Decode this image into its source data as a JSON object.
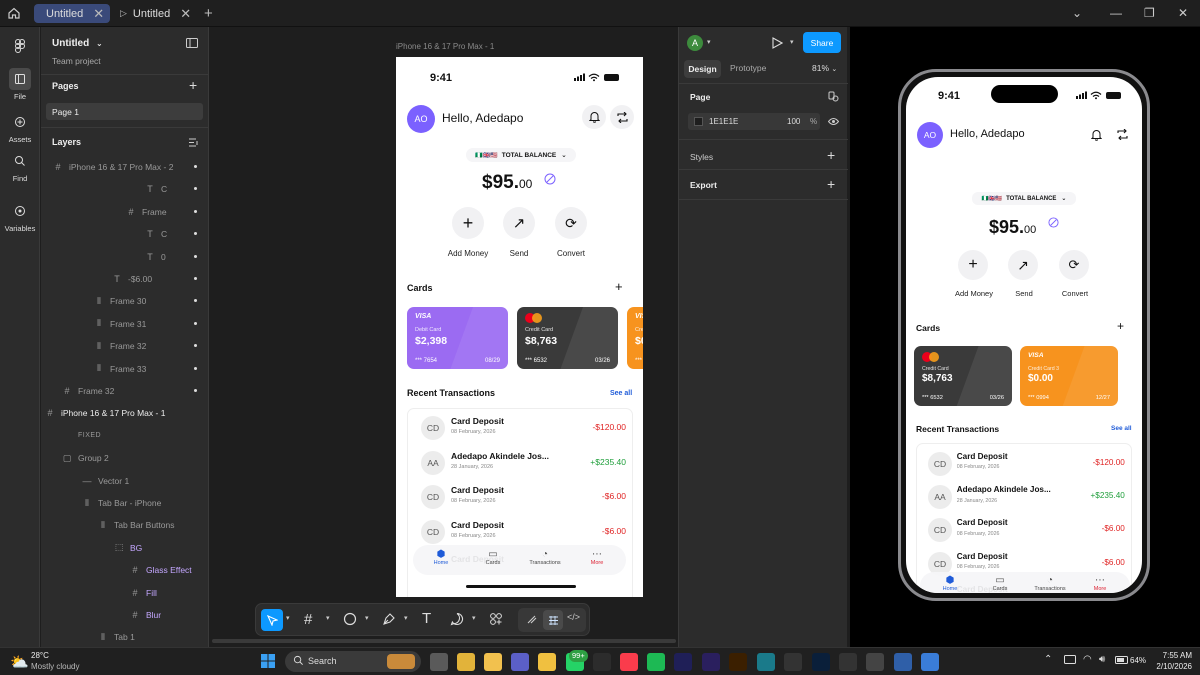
{
  "tabs": [
    {
      "label": "Untitled",
      "active": true
    },
    {
      "label": "Untitled",
      "active": false
    }
  ],
  "rail": {
    "items": [
      {
        "label": "File"
      },
      {
        "label": "Assets"
      },
      {
        "label": "Find"
      },
      {
        "label": "Variables"
      }
    ]
  },
  "file": {
    "name": "Untitled",
    "team": "Team project"
  },
  "pages": {
    "title": "Pages",
    "items": [
      "Page 1"
    ]
  },
  "layers": {
    "title": "Layers",
    "items": [
      {
        "label": "iPhone 16 & 17 Pro Max - 2",
        "icon": "frame"
      },
      {
        "label": "C",
        "icon": "text"
      },
      {
        "label": "Frame",
        "icon": "frame"
      },
      {
        "label": "C",
        "icon": "text"
      },
      {
        "label": "0",
        "icon": "text"
      },
      {
        "label": "-$6.00",
        "icon": "text"
      },
      {
        "label": "Frame 30",
        "icon": "autolayout"
      },
      {
        "label": "Frame 31",
        "icon": "autolayout"
      },
      {
        "label": "Frame 32",
        "icon": "autolayout"
      },
      {
        "label": "Frame 33",
        "icon": "autolayout"
      },
      {
        "label": "Frame 32",
        "icon": "frame"
      },
      {
        "label": "iPhone 16 & 17 Pro Max - 1",
        "icon": "frame"
      },
      {
        "label": "FIXED",
        "icon": ""
      },
      {
        "label": "Group 2",
        "icon": "group"
      },
      {
        "label": "Vector 1",
        "icon": "vector"
      },
      {
        "label": "Tab Bar - iPhone",
        "icon": "autolayout"
      },
      {
        "label": "Tab Bar Buttons",
        "icon": "autolayout"
      },
      {
        "label": "BG",
        "icon": "component"
      },
      {
        "label": "Glass Effect",
        "icon": "frame"
      },
      {
        "label": "Fill",
        "icon": "frame"
      },
      {
        "label": "Blur",
        "icon": "frame"
      },
      {
        "label": "Tab 1",
        "icon": "autolayout"
      }
    ]
  },
  "canvas": {
    "frame_label": "iPhone 16 & 17 Pro Max - 1"
  },
  "app": {
    "time": "9:41",
    "avatar": "AO",
    "greeting": "Hello, Adedapo",
    "balance_label": "TOTAL BALANCE",
    "balance_main": "$95.",
    "balance_cents": "00",
    "actions": [
      "Add Money",
      "Send",
      "Convert"
    ],
    "cards_title": "Cards",
    "cards": [
      {
        "brand": "VISA",
        "type": "Debit Card",
        "amount": "$2,398",
        "number": "*** 7654",
        "expiry": "08/29",
        "color": "#9b6bf2"
      },
      {
        "brand": "mastercard",
        "type": "Credit Card",
        "amount": "$8,763",
        "number": "*** 6532",
        "expiry": "03/26",
        "color": "#3a3a3a"
      },
      {
        "brand": "VISA",
        "type": "Credit Card 3",
        "amount": "$0.00",
        "number": "*** 0994",
        "expiry": "12/27",
        "color": "#f7931e"
      }
    ],
    "recent_title": "Recent Transactions",
    "see_all": "See all",
    "transactions": [
      {
        "initials": "CD",
        "name": "Card Deposit",
        "date": "08 February, 2026",
        "amount": "-$120.00",
        "color": "#e02424"
      },
      {
        "initials": "AA",
        "name": "Adedapo Akindele Jos...",
        "date": "28 January, 2026",
        "amount": "+$235.40",
        "color": "#1e9e3a"
      },
      {
        "initials": "CD",
        "name": "Card Deposit",
        "date": "08 February, 2026",
        "amount": "-$6.00",
        "color": "#e02424"
      },
      {
        "initials": "CD",
        "name": "Card Deposit",
        "date": "08 February, 2026",
        "amount": "-$6.00",
        "color": "#e02424"
      },
      {
        "initials": "",
        "name": "Card Deposit",
        "date": "",
        "amount": "",
        "color": "#e02424"
      }
    ],
    "tabbar": [
      "Home",
      "Cards",
      "Transactions",
      "More"
    ]
  },
  "design": {
    "user": "A",
    "share": "Share",
    "tabs": [
      "Design",
      "Prototype"
    ],
    "zoom": "81%",
    "page_section": "Page",
    "page_color": "1E1E1E",
    "page_opacity": "100",
    "page_pct": "%",
    "styles": "Styles",
    "export": "Export"
  },
  "weather": {
    "temp": "28°C",
    "desc": "Mostly cloudy"
  },
  "taskbar": {
    "search": "Search",
    "badge": "99+"
  },
  "tray": {
    "battery": "64%",
    "time": "7:55 AM",
    "date": "2/10/2026"
  },
  "accent": "#0d99ff",
  "purple": "#7b61ff"
}
